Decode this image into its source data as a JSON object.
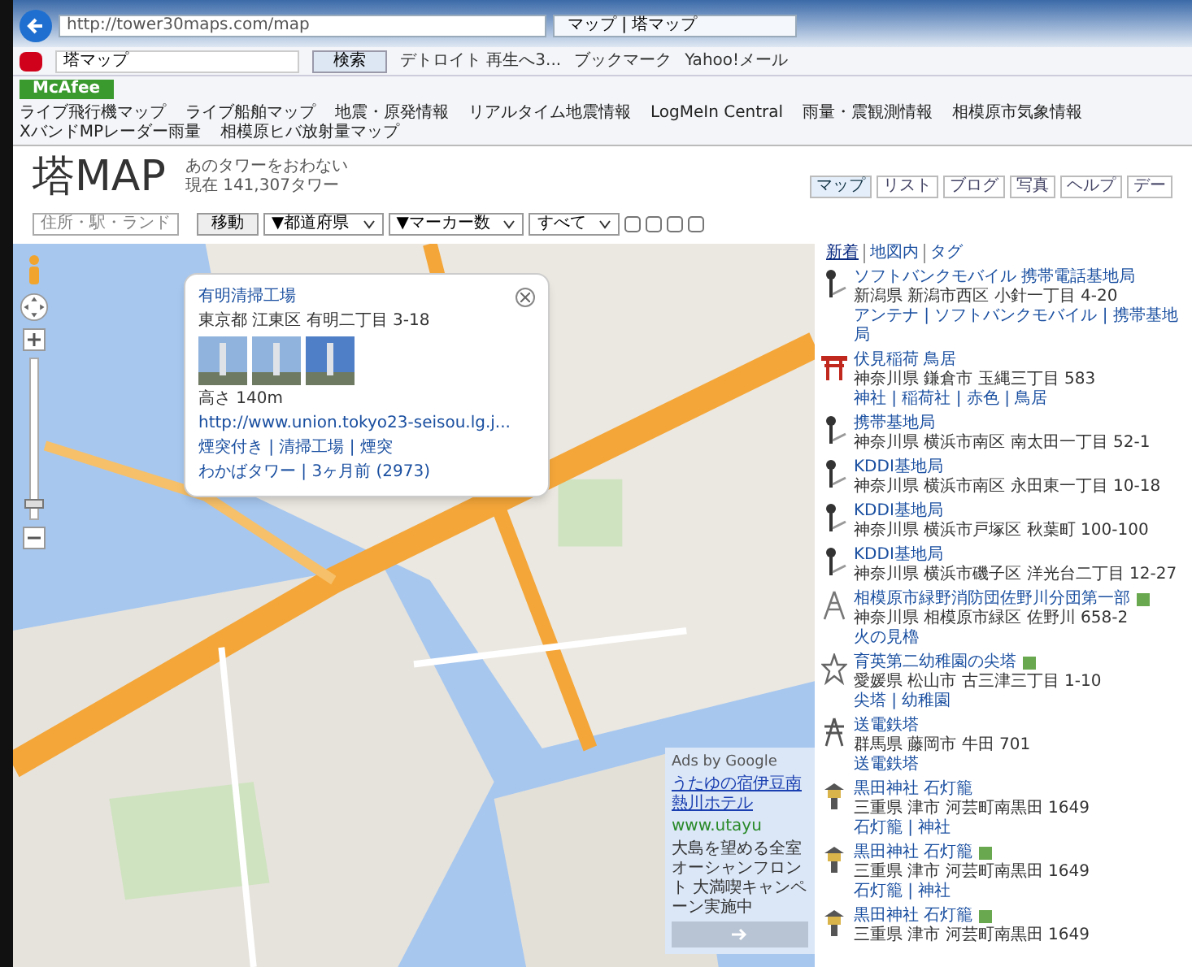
{
  "browser": {
    "address": "http://tower30maps.com/map",
    "tab": "マップ | 塔マップ",
    "toolbar": {
      "search_text": "塔マップ",
      "search_button": "検索",
      "items": [
        "デトロイト 再生へ3...",
        "ブックマーク",
        "Yahoo!メール"
      ]
    },
    "mcafee": "McAfee",
    "favorites": [
      "ライブ飛行機マップ",
      "ライブ船舶マップ",
      "地震・原発情報",
      "リアルタイム地震情報",
      "LogMeIn Central",
      "雨量・震観測情報",
      "相模原市気象情報",
      "XバンドMPレーダー雨量",
      "相模原ヒバ放射量マップ"
    ]
  },
  "header": {
    "logo_kanji": "塔",
    "logo_text": "MAP",
    "tagline": "あのタワーをおわない",
    "count": "現在 141,307タワー",
    "nav": [
      {
        "label": "マップ",
        "selected": true
      },
      {
        "label": "リスト",
        "selected": false
      },
      {
        "label": "ブログ",
        "selected": false
      },
      {
        "label": "写真",
        "selected": false
      },
      {
        "label": "ヘルプ",
        "selected": false
      },
      {
        "label": "デー",
        "selected": false
      }
    ]
  },
  "filters": {
    "placeholder": "住所・駅・ランド",
    "go": "移動",
    "selects": [
      "▼都道府県",
      "▼マーカー数",
      "すべて"
    ],
    "checkboxes": [
      {
        "checked": false
      },
      {
        "checked": false
      },
      {
        "checked": false
      },
      {
        "checked": false
      }
    ]
  },
  "map": {
    "popup": {
      "title": "有明清掃工場",
      "address": "東京都 江東区 有明二丁目 3-18",
      "height": "高さ 140m",
      "url": "http://www.union.tokyo23-seisou.lg.j...",
      "tags": "煙突付き | 清掃工場 | 煙突",
      "footer": "わかばタワー | 3ヶ月前 (2973)"
    },
    "ad": {
      "label": "Ads by Google",
      "title": "うたゆの宿伊豆南熱川ホテル",
      "url": "www.utayu",
      "body": "大島を望める全室オーシャンフロント 大満喫キャンペーン実施中"
    }
  },
  "sidebar": {
    "tabs": [
      {
        "label": "新着",
        "selected": true
      },
      {
        "label": "地図内",
        "selected": false
      },
      {
        "label": "タグ",
        "selected": false
      }
    ],
    "items": [
      {
        "kind": "antenna",
        "name": "ソフトバンクモバイル 携帯電話基地局",
        "photo": false,
        "address": "新潟県 新潟市西区 小針一丁目 4-20",
        "tags": "アンテナ | ソフトバンクモバイル | 携帯基地局"
      },
      {
        "kind": "torii",
        "name": "伏見稲荷 鳥居",
        "photo": false,
        "address": "神奈川県 鎌倉市 玉縄三丁目 583",
        "tags": "神社 | 稲荷社 | 赤色 | 鳥居"
      },
      {
        "kind": "antenna",
        "name": "携帯基地局",
        "photo": false,
        "address": "神奈川県 横浜市南区 南太田一丁目 52-1"
      },
      {
        "kind": "antenna",
        "name": "KDDI基地局",
        "photo": false,
        "address": "神奈川県 横浜市南区 永田東一丁目 10-18"
      },
      {
        "kind": "antenna",
        "name": "KDDI基地局",
        "photo": false,
        "address": "神奈川県 横浜市戸塚区 秋葉町 100-100"
      },
      {
        "kind": "antenna",
        "name": "KDDI基地局",
        "photo": false,
        "address": "神奈川県 横浜市磯子区 洋光台二丁目 12-27"
      },
      {
        "kind": "lookout",
        "name": "相模原市緑野消防団佐野川分団第一部",
        "photo": true,
        "address": "神奈川県 相模原市緑区 佐野川 658-2",
        "tags": "火の見櫓"
      },
      {
        "kind": "spire",
        "name": "育英第二幼稚園の尖塔",
        "photo": true,
        "address": "愛媛県 松山市 古三津三丁目 1-10",
        "tags": "尖塔 | 幼稚園"
      },
      {
        "kind": "pylon",
        "name": "送電鉄塔",
        "photo": false,
        "address": "群馬県 藤岡市 牛田 701",
        "tags": "送電鉄塔"
      },
      {
        "kind": "lantern",
        "name": "黒田神社 石灯籠",
        "photo": false,
        "address": "三重県 津市 河芸町南黒田 1649",
        "tags": "石灯籠 | 神社"
      },
      {
        "kind": "lantern",
        "name": "黒田神社 石灯籠",
        "photo": true,
        "address": "三重県 津市 河芸町南黒田 1649",
        "tags": "石灯籠 | 神社"
      },
      {
        "kind": "lantern",
        "name": "黒田神社 石灯籠",
        "photo": true,
        "address": "三重県 津市 河芸町南黒田 1649"
      }
    ]
  }
}
